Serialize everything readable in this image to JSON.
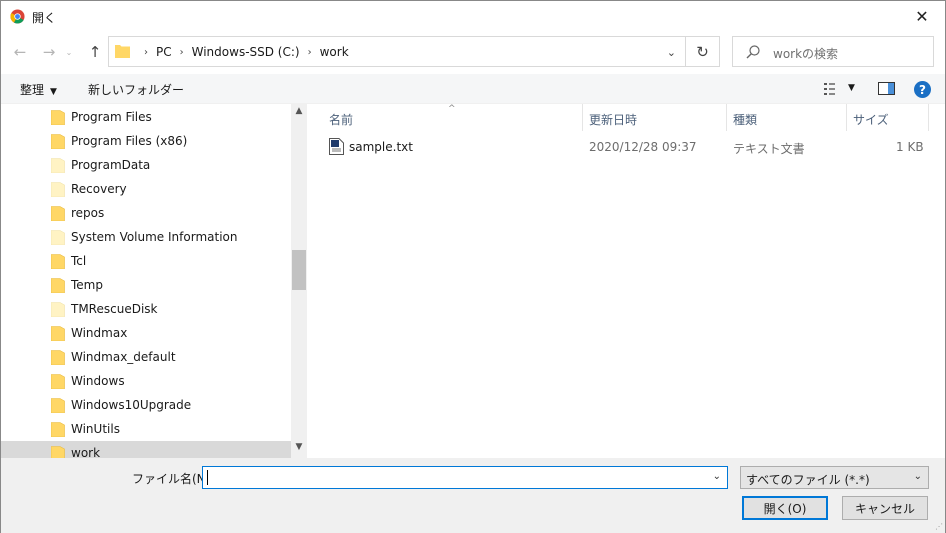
{
  "window": {
    "title": "開く",
    "close_glyph": "✕"
  },
  "address": {
    "crumbs": [
      "PC",
      "Windows-SSD (C:)",
      "work"
    ],
    "separator": "›"
  },
  "search": {
    "placeholder": "workの検索"
  },
  "toolbar": {
    "organize": "整理",
    "new_folder": "新しいフォルダー",
    "help": "?"
  },
  "nav": {
    "items": [
      {
        "label": "Program Files",
        "faded": false
      },
      {
        "label": "Program Files (x86)",
        "faded": false
      },
      {
        "label": "ProgramData",
        "faded": true
      },
      {
        "label": "Recovery",
        "faded": true
      },
      {
        "label": "repos",
        "faded": false
      },
      {
        "label": "System Volume Information",
        "faded": true
      },
      {
        "label": "Tcl",
        "faded": false
      },
      {
        "label": "Temp",
        "faded": false
      },
      {
        "label": "TMRescueDisk",
        "faded": true
      },
      {
        "label": "Windmax",
        "faded": false
      },
      {
        "label": "Windmax_default",
        "faded": false
      },
      {
        "label": "Windows",
        "faded": false
      },
      {
        "label": "Windows10Upgrade",
        "faded": false
      },
      {
        "label": "WinUtils",
        "faded": false
      },
      {
        "label": "work",
        "faded": false,
        "selected": true
      }
    ]
  },
  "list": {
    "columns": [
      "名前",
      "更新日時",
      "種類",
      "サイズ"
    ],
    "rows": [
      {
        "name": "sample.txt",
        "modified": "2020/12/28 09:37",
        "type": "テキスト文書",
        "size": "1 KB"
      }
    ]
  },
  "bottom": {
    "filename_label": "ファイル名(N):",
    "filename_value": "",
    "filetype": "すべてのファイル (*.*)",
    "open_button": "開く(O)",
    "cancel_button": "キャンセル"
  },
  "colors": {
    "accent": "#0078d7",
    "folder": "#ffd766",
    "selected_bg": "#d9d9d9"
  }
}
